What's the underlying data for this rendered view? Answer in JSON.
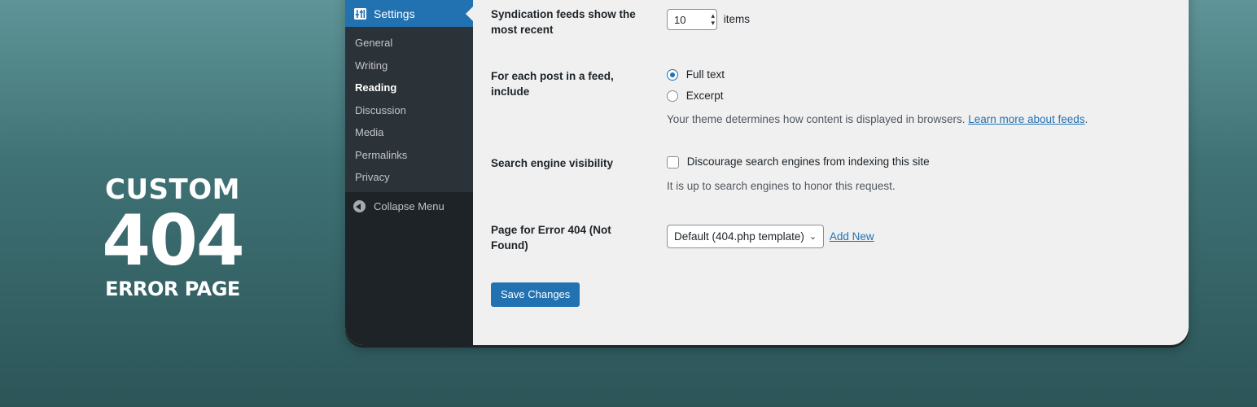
{
  "headline": {
    "line1": "CUSTOM",
    "line2": "404",
    "line3": "ERROR PAGE"
  },
  "sidebar": {
    "active_menu": "Settings",
    "items": [
      {
        "label": "General"
      },
      {
        "label": "Writing"
      },
      {
        "label": "Reading",
        "current": true
      },
      {
        "label": "Discussion"
      },
      {
        "label": "Media"
      },
      {
        "label": "Permalinks"
      },
      {
        "label": "Privacy"
      }
    ],
    "collapse_label": "Collapse Menu"
  },
  "form": {
    "feeds": {
      "label": "Syndication feeds show the most recent",
      "value": "10",
      "suffix": "items"
    },
    "feed_content": {
      "label": "For each post in a feed, include",
      "options": [
        "Full text",
        "Excerpt"
      ],
      "selected": "Full text",
      "desc": "Your theme determines how content is displayed in browsers.",
      "link": "Learn more about feeds",
      "desc_end": "."
    },
    "search": {
      "label": "Search engine visibility",
      "checkbox_label": "Discourage search engines from indexing this site",
      "checked": false,
      "desc": "It is up to search engines to honor this request."
    },
    "error404": {
      "label": "Page for Error 404 (Not Found)",
      "selected": "Default (404.php template)",
      "add_new": "Add New"
    },
    "save_label": "Save Changes"
  },
  "colors": {
    "accent": "#2271b1",
    "sidebar": "#1d2327",
    "submenu": "#2c3338",
    "content_bg": "#f0f0f1"
  }
}
